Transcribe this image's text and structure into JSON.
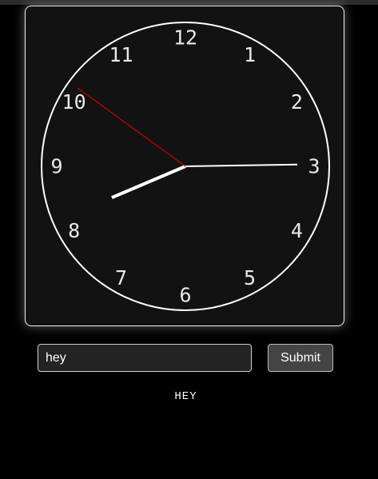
{
  "clock": {
    "numbers": [
      "12",
      "1",
      "2",
      "3",
      "4",
      "5",
      "6",
      "7",
      "8",
      "9",
      "10",
      "11"
    ],
    "time": {
      "hour": 8,
      "minute": 14,
      "second": 51
    },
    "colors": {
      "face": "#121212",
      "ring": "#ffffff",
      "hour_hand": "#ffffff",
      "minute_hand": "#ffffff",
      "second_hand": "#cc0000"
    }
  },
  "form": {
    "input_value": "hey",
    "submit_label": "Submit"
  },
  "output": {
    "text": "HEY"
  }
}
